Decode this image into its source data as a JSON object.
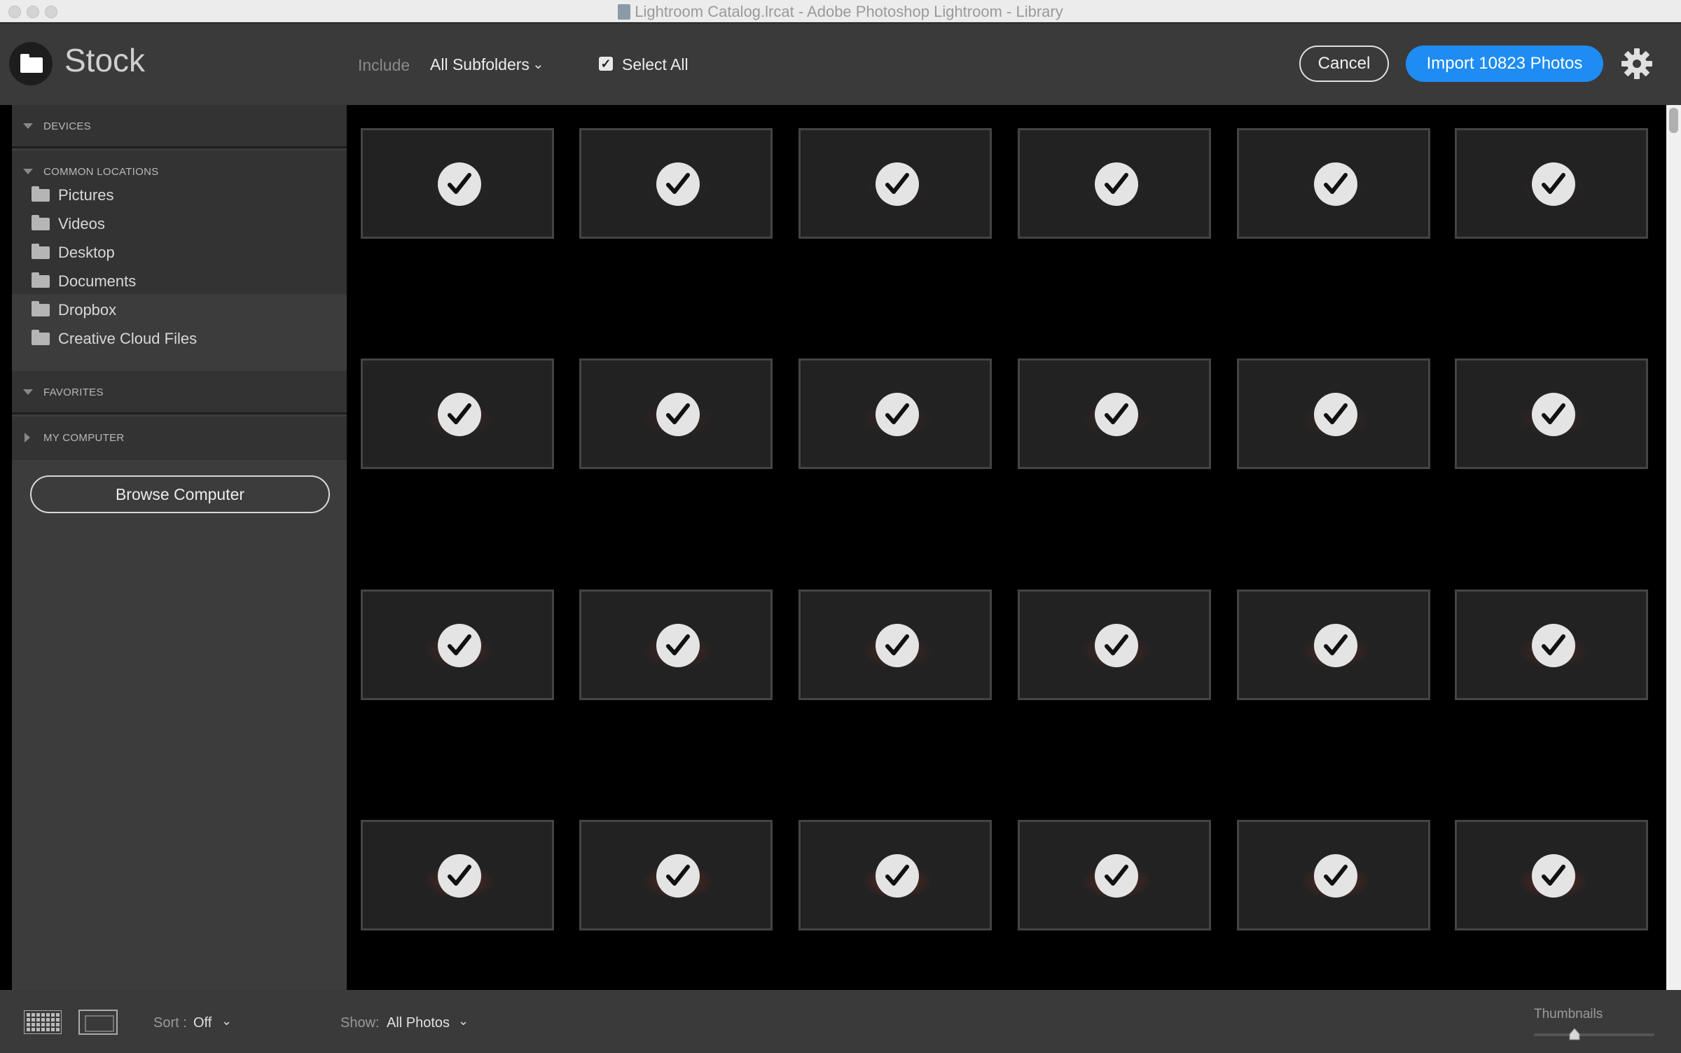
{
  "window": {
    "title": "Lightroom Catalog.lrcat - Adobe Photoshop Lightroom - Library"
  },
  "header": {
    "source_name": "Stock",
    "include_label": "Include",
    "include_value": "All Subfolders",
    "select_all_label": "Select All",
    "select_all_checked": true,
    "cancel_label": "Cancel",
    "import_label": "Import 10823 Photos",
    "import_color": "#1e8cf2"
  },
  "sidebar": {
    "devices_label": "DEVICES",
    "common_locations_label": "COMMON LOCATIONS",
    "locations": [
      "Pictures",
      "Videos",
      "Desktop",
      "Documents",
      "Dropbox",
      "Creative Cloud Files"
    ],
    "favorites_label": "FAVORITES",
    "my_computer_label": "MY COMPUTER",
    "browse_label": "Browse Computer"
  },
  "grid": {
    "rows": 4,
    "columns": 6,
    "all_checked": true
  },
  "footer": {
    "sort_label": "Sort :",
    "sort_value": "Off",
    "show_label": "Show:",
    "show_value": "All Photos",
    "thumbnails_label": "Thumbnails"
  }
}
